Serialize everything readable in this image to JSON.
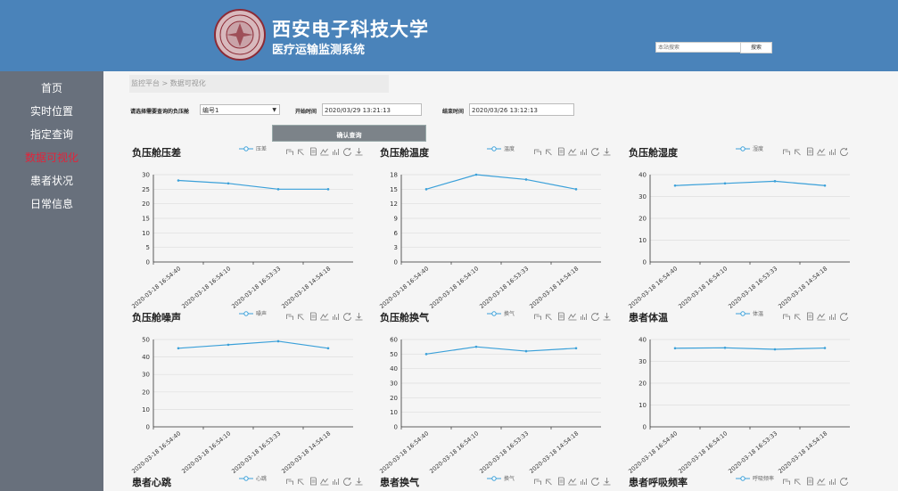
{
  "header": {
    "university": "西安电子科技大学",
    "system": "医疗运输监测系统",
    "search_placeholder": "本站搜索",
    "search_button": "搜索",
    "accent": "#4a83ba"
  },
  "sidebar": {
    "items": [
      {
        "label": "首页",
        "active": false
      },
      {
        "label": "实时位置",
        "active": false
      },
      {
        "label": "指定查询",
        "active": false
      },
      {
        "label": "数据可视化",
        "active": true
      },
      {
        "label": "患者状况",
        "active": false
      },
      {
        "label": "日常信息",
        "active": false
      }
    ]
  },
  "breadcrumb": "监控平台 > 数据可视化",
  "form": {
    "select_label": "请选择需要查询的负压舱",
    "select_value": "编号1",
    "start_label": "开始时间",
    "start_value": "2020/03/29 13:21:13",
    "end_label": "结束时间",
    "end_value": "2020/03/26 13:12:13",
    "confirm_button": "确认查询"
  },
  "toolbox_icons": [
    "zoom-icon",
    "zoom-reset-icon",
    "data-view-icon",
    "line-switch-icon",
    "bar-switch-icon",
    "restore-icon",
    "download-icon"
  ],
  "chart_data": [
    {
      "type": "line",
      "title": "负压舱压差",
      "series": [
        {
          "name": "压差",
          "values": [
            28,
            27,
            25,
            25
          ]
        }
      ],
      "x": [
        "2020-03-18 16:54:40",
        "2020-03-18 16:54:10",
        "2020-03-18 16:53:33",
        "2020-03-18 14:54:18"
      ],
      "ylim": [
        0,
        30
      ],
      "yticks": [
        0,
        5,
        10,
        15,
        20,
        25,
        30
      ],
      "grid": true,
      "legend": "top-center",
      "color": "#3aa0d9"
    },
    {
      "type": "line",
      "title": "负压舱温度",
      "series": [
        {
          "name": "温度",
          "values": [
            15,
            18,
            17,
            15
          ]
        }
      ],
      "x": [
        "2020-03-18 16:54:40",
        "2020-03-18 16:54:10",
        "2020-03-18 16:53:33",
        "2020-03-18 14:54:18"
      ],
      "ylim": [
        0,
        18
      ],
      "yticks": [
        0,
        3,
        6,
        9,
        12,
        15,
        18
      ],
      "grid": true,
      "legend": "top-center",
      "color": "#3aa0d9"
    },
    {
      "type": "line",
      "title": "负压舱湿度",
      "series": [
        {
          "name": "湿度",
          "values": [
            35,
            36,
            37,
            35
          ]
        }
      ],
      "x": [
        "2020-03-18 16:54:40",
        "2020-03-18 16:54:10",
        "2020-03-18 16:53:33",
        "2020-03-18 14:54:18"
      ],
      "ylim": [
        0,
        40
      ],
      "yticks": [
        0,
        10,
        20,
        30,
        40
      ],
      "grid": true,
      "legend": "top-center",
      "color": "#3aa0d9"
    },
    {
      "type": "line",
      "title": "负压舱噪声",
      "series": [
        {
          "name": "噪声",
          "values": [
            45,
            47,
            49,
            45
          ]
        }
      ],
      "x": [
        "2020-03-18 16:54:40",
        "2020-03-18 16:54:10",
        "2020-03-18 16:53:33",
        "2020-03-18 14:54:18"
      ],
      "ylim": [
        0,
        50
      ],
      "yticks": [
        0,
        10,
        20,
        30,
        40,
        50
      ],
      "grid": true,
      "legend": "top-center",
      "color": "#3aa0d9"
    },
    {
      "type": "line",
      "title": "负压舱换气",
      "series": [
        {
          "name": "换气",
          "values": [
            50,
            55,
            52,
            54
          ]
        }
      ],
      "x": [
        "2020-03-18 16:54:40",
        "2020-03-18 16:54:10",
        "2020-03-18 16:53:33",
        "2020-03-18 14:54:18"
      ],
      "ylim": [
        0,
        60
      ],
      "yticks": [
        0,
        10,
        20,
        30,
        40,
        50,
        60
      ],
      "grid": true,
      "legend": "top-center",
      "color": "#3aa0d9"
    },
    {
      "type": "line",
      "title": "患者体温",
      "series": [
        {
          "name": "体温",
          "values": [
            36,
            36.2,
            35.5,
            36.1
          ]
        }
      ],
      "x": [
        "2020-03-18 16:54:40",
        "2020-03-18 16:54:10",
        "2020-03-18 16:53:33",
        "2020-03-18 14:54:18"
      ],
      "ylim": [
        0,
        40
      ],
      "yticks": [
        0,
        10,
        20,
        30,
        40
      ],
      "grid": true,
      "legend": "top-center",
      "color": "#3aa0d9"
    },
    {
      "type": "line",
      "title": "患者心跳",
      "series": [
        {
          "name": "心跳",
          "values": []
        }
      ],
      "x": [],
      "legend": "top-center",
      "color": "#3aa0d9"
    },
    {
      "type": "line",
      "title": "患者换气",
      "series": [
        {
          "name": "换气",
          "values": []
        }
      ],
      "x": [],
      "legend": "top-center",
      "color": "#3aa0d9"
    },
    {
      "type": "line",
      "title": "患者呼吸频率",
      "series": [
        {
          "name": "呼吸频率",
          "values": []
        }
      ],
      "x": [],
      "legend": "top-center",
      "color": "#3aa0d9"
    }
  ]
}
